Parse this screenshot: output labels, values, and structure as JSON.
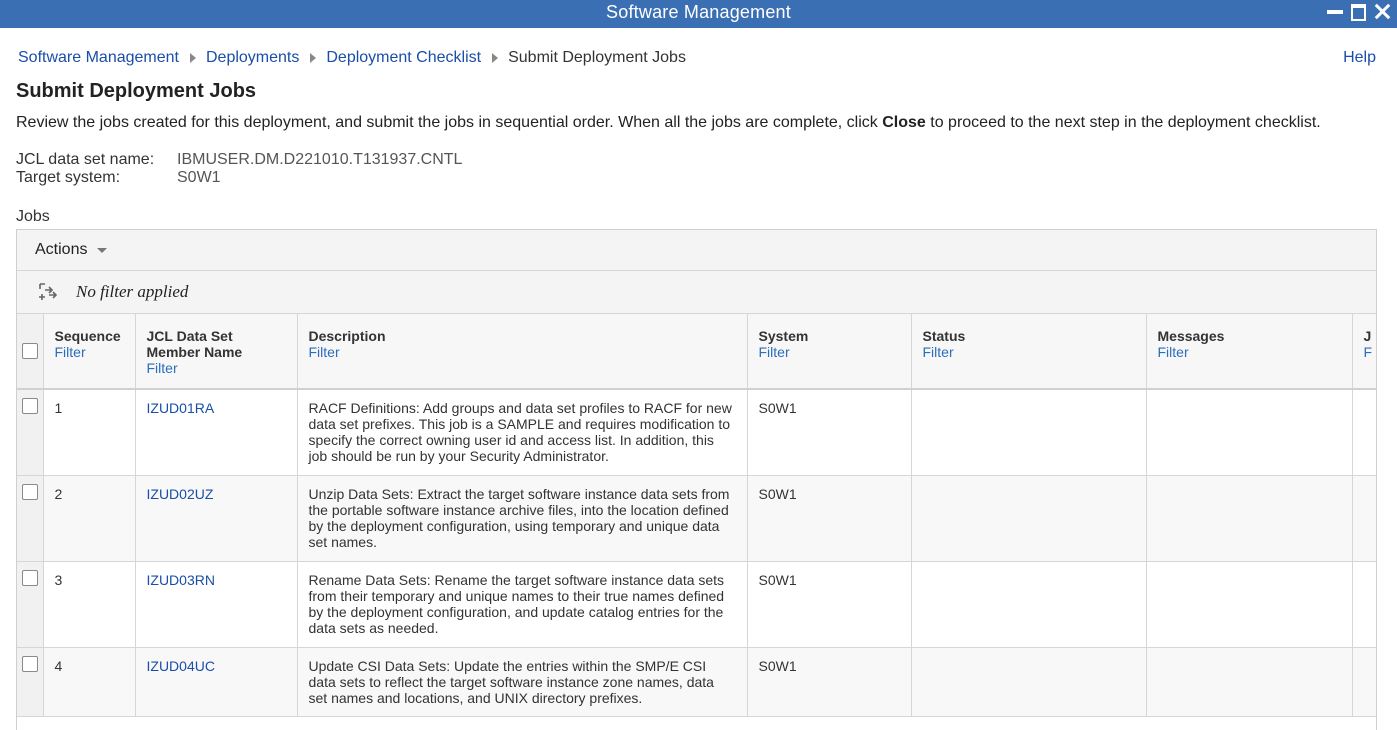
{
  "window": {
    "title": "Software Management",
    "controls": [
      "minimize-icon",
      "maximize-icon",
      "close-icon"
    ]
  },
  "breadcrumb": {
    "items": [
      "Software Management",
      "Deployments",
      "Deployment Checklist"
    ],
    "current": "Submit Deployment Jobs"
  },
  "help": "Help",
  "page": {
    "title": "Submit Deployment Jobs",
    "intro_before": "Review the jobs created for this deployment, and submit the jobs in sequential order. When all the jobs are complete, click ",
    "intro_bold": "Close",
    "intro_after": " to proceed to the next step in the deployment checklist."
  },
  "properties": {
    "jcl_label": "JCL data set name:",
    "jcl_value": "IBMUSER.DM.D221010.T131937.CNTL",
    "target_label": "Target system:",
    "target_value": "S0W1"
  },
  "jobs_label": "Jobs",
  "toolbar": {
    "actions": "Actions",
    "filter_status": "No filter applied"
  },
  "table": {
    "columns": [
      {
        "label": "Sequence",
        "filter": "Filter"
      },
      {
        "label": "JCL Data Set Member Name",
        "filter": "Filter"
      },
      {
        "label": "Description",
        "filter": "Filter"
      },
      {
        "label": "System",
        "filter": "Filter"
      },
      {
        "label": "Status",
        "filter": "Filter"
      },
      {
        "label": "Messages",
        "filter": "Filter"
      },
      {
        "label": "J",
        "filter": "F"
      }
    ],
    "rows": [
      {
        "sequence": "1",
        "member": "IZUD01RA",
        "description": "RACF Definitions: Add groups and data set profiles to RACF for new data set prefixes. This job is a SAMPLE and requires modification to specify the correct owning user id and access list. In addition, this job should be run by your Security Administrator.",
        "system": "S0W1",
        "status": "",
        "messages": ""
      },
      {
        "sequence": "2",
        "member": "IZUD02UZ",
        "description": "Unzip Data Sets: Extract the target software instance data sets from the portable software instance archive files, into the location defined by the deployment configuration, using temporary and unique data set names.",
        "system": "S0W1",
        "status": "",
        "messages": ""
      },
      {
        "sequence": "3",
        "member": "IZUD03RN",
        "description": "Rename Data Sets: Rename the target software instance data sets from their temporary and unique names to their true names defined by the deployment configuration, and update catalog entries for the data sets as needed.",
        "system": "S0W1",
        "status": "",
        "messages": ""
      },
      {
        "sequence": "4",
        "member": "IZUD04UC",
        "description": "Update CSI Data Sets: Update the entries within the SMP/E CSI data sets to reflect the target software instance zone names, data set names and locations, and UNIX directory prefixes.",
        "system": "S0W1",
        "status": "",
        "messages": ""
      }
    ]
  }
}
